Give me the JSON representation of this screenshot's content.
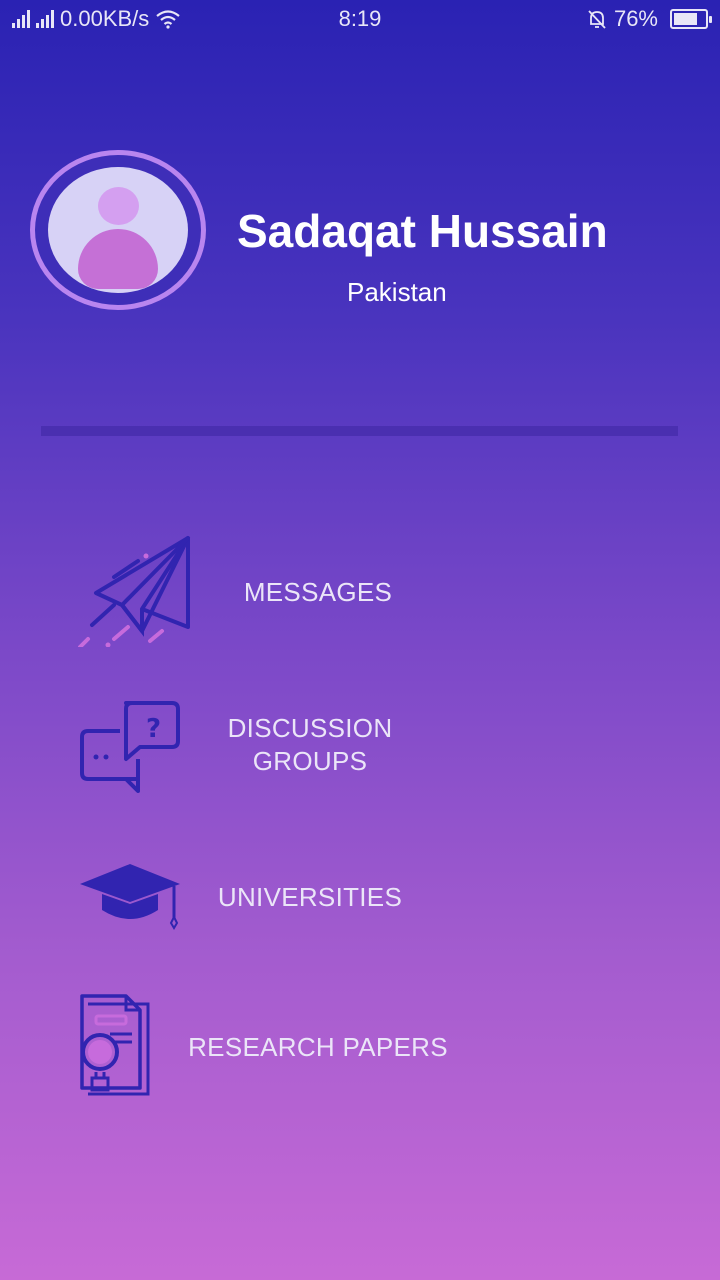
{
  "status_bar": {
    "network_speed": "0.00KB/s",
    "time": "8:19",
    "battery_percent": "76%",
    "battery_level": 0.76
  },
  "profile": {
    "name": "Sadaqat Hussain",
    "country": "Pakistan"
  },
  "menu": [
    {
      "label": "MESSAGES",
      "icon": "paper-plane-icon"
    },
    {
      "label_line1": "DISCUSSION",
      "label_line2": "GROUPS",
      "icon": "chat-bubbles-icon"
    },
    {
      "label": "UNIVERSITIES",
      "icon": "graduation-cap-icon"
    },
    {
      "label": "RESEARCH PAPERS",
      "icon": "research-document-icon"
    }
  ],
  "colors": {
    "icon_stroke": "#3124b0",
    "icon_accent": "#c76bdc",
    "avatar_ring": "#b985ef"
  }
}
